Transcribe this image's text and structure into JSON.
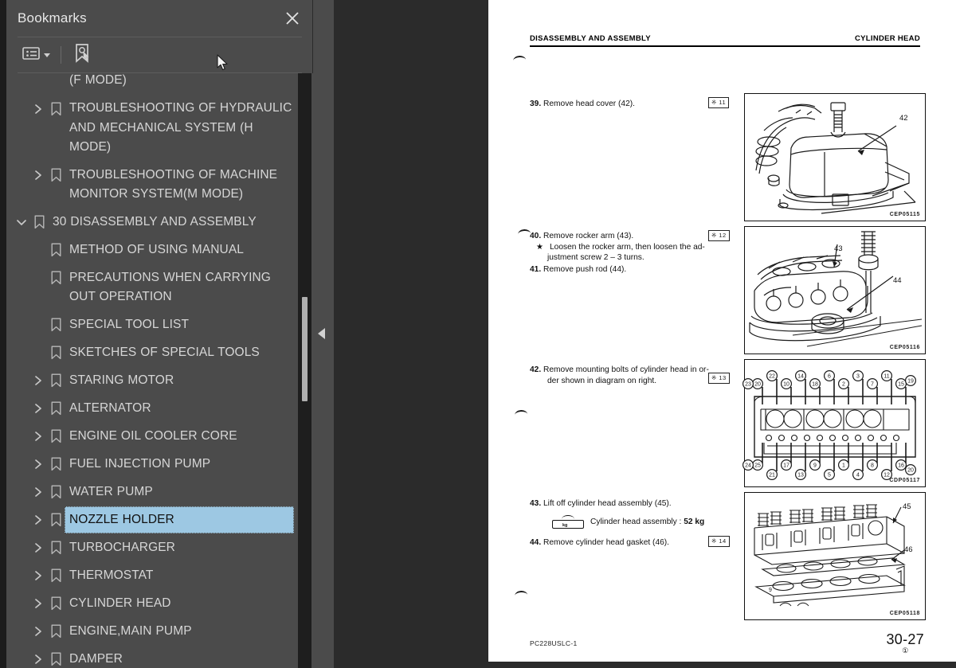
{
  "panel": {
    "title": "Bookmarks",
    "close_icon": "close-icon",
    "toolbar": {
      "options_icon": "list-options-icon",
      "options_caret": "chevron-down-icon",
      "new_bookmark_icon": "new-bookmark-icon"
    },
    "items": [
      {
        "label": "(F MODE)",
        "indent": 2,
        "twisty": "none",
        "bookmark": false,
        "selected": false
      },
      {
        "label": "TROUBLESHOOTING OF HYDRAULIC AND MECHANICAL SYSTEM (H MODE)",
        "indent": 2,
        "twisty": "collapsed",
        "bookmark": true,
        "selected": false
      },
      {
        "label": "TROUBLESHOOTING OF MACHINE MONITOR SYSTEM(M MODE)",
        "indent": 2,
        "twisty": "collapsed",
        "bookmark": true,
        "selected": false
      },
      {
        "label": "30 DISASSEMBLY AND ASSEMBLY",
        "indent": 1,
        "twisty": "expanded",
        "bookmark": true,
        "selected": false
      },
      {
        "label": "METHOD OF USING MANUAL",
        "indent": 2,
        "twisty": "none",
        "bookmark": true,
        "selected": false
      },
      {
        "label": "PRECAUTIONS WHEN CARRYING OUT OPERATION",
        "indent": 2,
        "twisty": "none",
        "bookmark": true,
        "selected": false
      },
      {
        "label": "SPECIAL TOOL LIST",
        "indent": 2,
        "twisty": "none",
        "bookmark": true,
        "selected": false
      },
      {
        "label": "SKETCHES OF SPECIAL TOOLS",
        "indent": 2,
        "twisty": "none",
        "bookmark": true,
        "selected": false
      },
      {
        "label": "STARING MOTOR",
        "indent": 2,
        "twisty": "collapsed",
        "bookmark": true,
        "selected": false
      },
      {
        "label": "ALTERNATOR",
        "indent": 2,
        "twisty": "collapsed",
        "bookmark": true,
        "selected": false
      },
      {
        "label": "ENGINE OIL COOLER CORE",
        "indent": 2,
        "twisty": "collapsed",
        "bookmark": true,
        "selected": false
      },
      {
        "label": "FUEL INJECTION PUMP",
        "indent": 2,
        "twisty": "collapsed",
        "bookmark": true,
        "selected": false
      },
      {
        "label": "WATER PUMP",
        "indent": 2,
        "twisty": "collapsed",
        "bookmark": true,
        "selected": false
      },
      {
        "label": "NOZZLE HOLDER",
        "indent": 2,
        "twisty": "collapsed",
        "bookmark": true,
        "selected": true
      },
      {
        "label": "TURBOCHARGER",
        "indent": 2,
        "twisty": "collapsed",
        "bookmark": true,
        "selected": false
      },
      {
        "label": "THERMOSTAT",
        "indent": 2,
        "twisty": "collapsed",
        "bookmark": true,
        "selected": false
      },
      {
        "label": "CYLINDER HEAD",
        "indent": 2,
        "twisty": "collapsed",
        "bookmark": true,
        "selected": false
      },
      {
        "label": "ENGINE,MAIN PUMP",
        "indent": 2,
        "twisty": "collapsed",
        "bookmark": true,
        "selected": false
      },
      {
        "label": "DAMPER",
        "indent": 2,
        "twisty": "collapsed",
        "bookmark": true,
        "selected": false
      }
    ]
  },
  "gutter": {
    "collapse_icon": "collapse-panel-arrow-icon"
  },
  "document": {
    "header_left": "DISASSEMBLY AND ASSEMBLY",
    "header_right": "CYLINDER HEAD",
    "steps": [
      {
        "number": "39.",
        "text": "Remove head cover (42).",
        "ref": "※ 11"
      },
      {
        "number": "40.",
        "text": "Remove rocker arm (43).",
        "ref": "※ 12",
        "note_bullet": "★",
        "note_line1": "Loosen the rocker arm, then loosen the ad-",
        "note_line2": "justment screw 2 – 3 turns."
      },
      {
        "number": "41.",
        "text": "Remove push rod (44)."
      },
      {
        "number": "42.",
        "text_line1": "Remove mounting bolts of cylinder head in or-",
        "text_line2": "der shown in diagram on right.",
        "ref": "※ 13"
      },
      {
        "number": "43.",
        "text": "Lift off cylinder head assembly (45).",
        "weight_icon": "lifting-weight-icon",
        "weight_unit": "kg",
        "weight_label": "Cylinder head assembly :",
        "weight_value": "52 kg"
      },
      {
        "number": "44.",
        "text": "Remove cylinder head gasket (46).",
        "ref": "※ 14"
      }
    ],
    "figures": [
      {
        "caption": "CEP05115",
        "labels": [
          "42"
        ],
        "alt": "head-cover-diagram"
      },
      {
        "caption": "CEP05116",
        "labels": [
          "43",
          "44"
        ],
        "alt": "rocker-arm-push-rod-diagram"
      },
      {
        "caption": "CDP05117",
        "alt": "cylinder-head-bolt-loosening-order-diagram",
        "top_numbers": [
          "20",
          "22",
          "10",
          "14",
          "18",
          "6",
          "2",
          "3",
          "7",
          "11",
          "15",
          "19",
          "23"
        ],
        "bottom_numbers": [
          "25",
          "21",
          "17",
          "13",
          "9",
          "5",
          "1",
          "4",
          "8",
          "12",
          "16",
          "20",
          "24"
        ]
      },
      {
        "caption": "CEP05118",
        "labels": [
          "45",
          "46"
        ],
        "alt": "cylinder-head-assembly-gasket-diagram"
      }
    ],
    "footer_left": "PC228USLC-1",
    "footer_page": "30-27",
    "footer_sub": "①"
  },
  "colors": {
    "panel_bg": "#4b4b4b",
    "panel_text": "#d6d6d6",
    "selection_bg": "#9dc8e3",
    "gutter_bg": "#2b2b2b",
    "scrollbar_track": "#1e1e1e",
    "scrollbar_thumb": "#b0b0b0",
    "page_bg": "#ffffff"
  }
}
